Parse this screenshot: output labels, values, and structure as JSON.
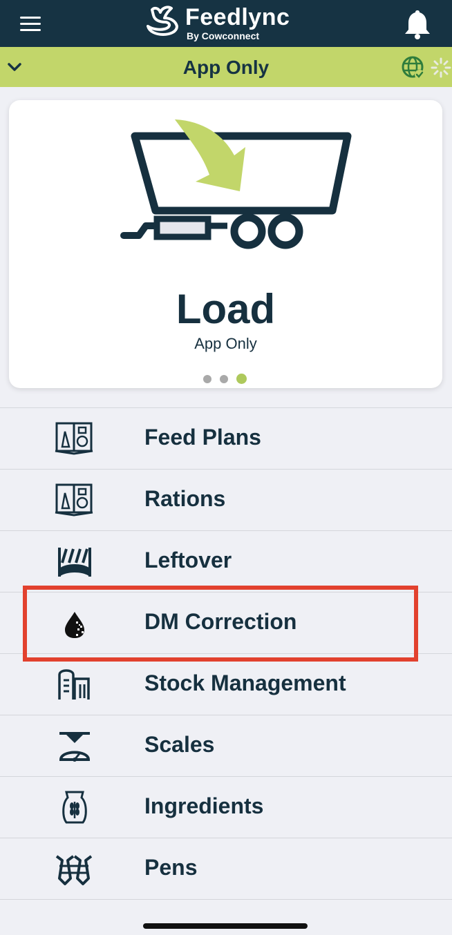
{
  "header": {
    "logo_text": "Feedlync",
    "logo_subtext": "By Cowconnect",
    "menu_icon": "hamburger-icon",
    "notification_icon": "bell-icon"
  },
  "subbar": {
    "title": "App Only",
    "dropdown_icon": "chevron-down-icon",
    "status_icon": "globe-check-icon",
    "loading_icon": "spinner-icon"
  },
  "card": {
    "title": "Load",
    "subtitle": "App Only",
    "icon": "feed-wagon-load-icon",
    "pagination": {
      "total": 3,
      "active": 3
    }
  },
  "menu": {
    "items": [
      {
        "label": "Feed Plans",
        "icon": "feed-plan-book-icon"
      },
      {
        "label": "Rations",
        "icon": "ration-book-icon"
      },
      {
        "label": "Leftover",
        "icon": "leftover-icon"
      },
      {
        "label": "DM Correction",
        "icon": "dry-matter-drop-icon",
        "highlighted": true
      },
      {
        "label": "Stock Management",
        "icon": "silo-icon"
      },
      {
        "label": "Scales",
        "icon": "scales-icon"
      },
      {
        "label": "Ingredients",
        "icon": "grain-sack-icon"
      },
      {
        "label": "Pens",
        "icon": "cows-icon"
      }
    ]
  },
  "colors": {
    "header_bg": "#163343",
    "accent_green": "#c2d66a",
    "highlight_red": "#e2412e",
    "text_dark": "#16303f"
  }
}
